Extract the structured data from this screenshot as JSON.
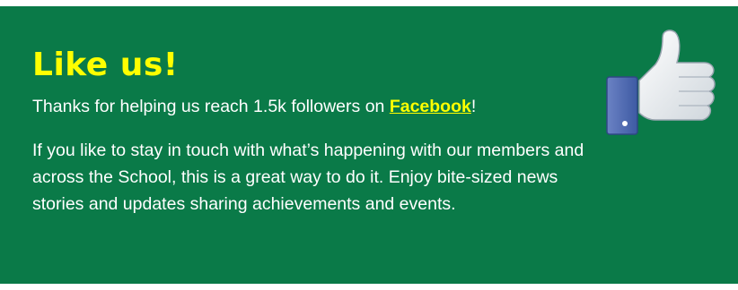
{
  "banner": {
    "heading": "Like us!",
    "intro_before": "Thanks for helping us reach 1.5k followers on ",
    "link_label": "Facebook",
    "intro_after": "!",
    "body": "If you like to stay in touch with what’s happening with our members and across the School, this is a great way to do it. Enjoy bite-sized news stories and updates sharing achievements and events.",
    "icon": "thumbs-up-icon"
  },
  "colors": {
    "background": "#0a7a48",
    "accent": "#ffff00",
    "text": "#ffffff"
  }
}
